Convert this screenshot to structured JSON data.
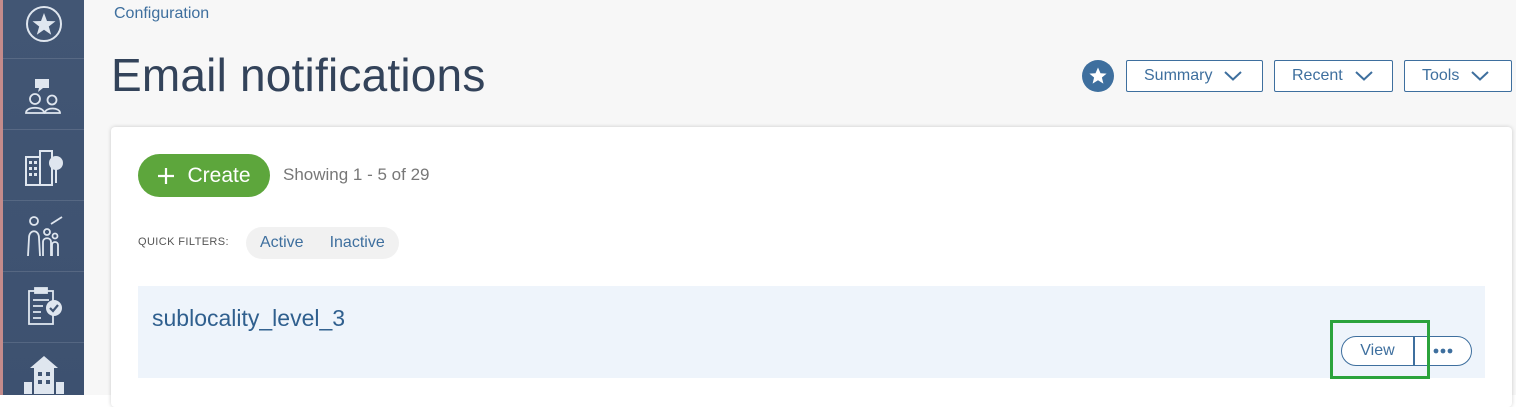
{
  "sidebar": {
    "items": [
      {
        "icon": "star-circle-icon"
      },
      {
        "icon": "people-chat-icon"
      },
      {
        "icon": "buildings-tree-icon"
      },
      {
        "icon": "family-icon"
      },
      {
        "icon": "checklist-clipboard-icon"
      },
      {
        "icon": "house-building-icon"
      }
    ]
  },
  "header": {
    "breadcrumb": "Configuration",
    "title": "Email notifications",
    "favorite_icon": "star-icon",
    "buttons": [
      {
        "label": "Summary"
      },
      {
        "label": "Recent"
      },
      {
        "label": "Tools"
      }
    ]
  },
  "toolbar": {
    "create_label": "Create",
    "showing_text": "Showing 1 - 5 of 29"
  },
  "quick_filters": {
    "label": "QUICK FILTERS:",
    "items": [
      {
        "label": "Active"
      },
      {
        "label": "Inactive"
      }
    ]
  },
  "rows": [
    {
      "title": "sublocality_level_3",
      "view_label": "View"
    }
  ],
  "colors": {
    "accent": "#3e6f9e",
    "create_green": "#5da63c",
    "highlight": "#2ba33c",
    "sidebar_bg": "#425674"
  }
}
